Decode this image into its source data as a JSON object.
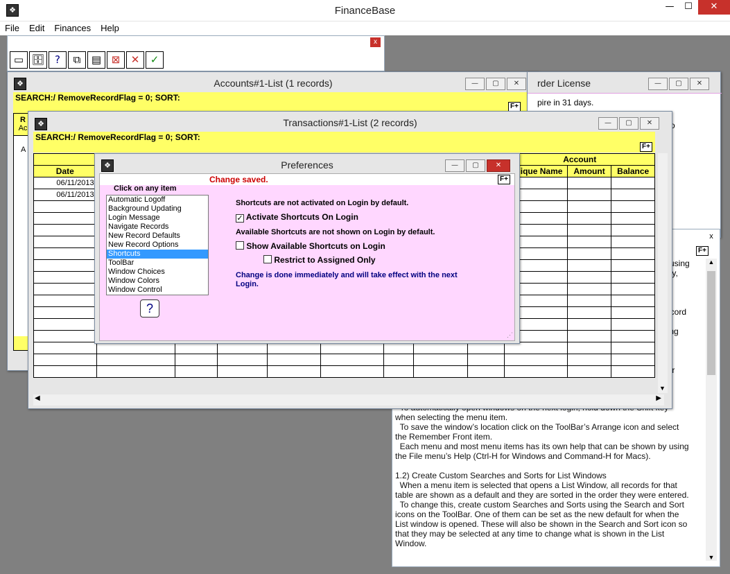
{
  "app": {
    "title": "FinanceBase",
    "min": "—",
    "max": "☐",
    "close": "✕"
  },
  "menu": [
    "File",
    "Edit",
    "Finances",
    "Help"
  ],
  "toolbar": {
    "close": "x",
    "buttons": [
      {
        "icon": "window-icon",
        "glyph": "▭"
      },
      {
        "icon": "database-icon",
        "glyph": "🗄"
      },
      {
        "icon": "help-icon",
        "glyph": "?"
      },
      {
        "icon": "arrange-icon",
        "glyph": "⧉"
      },
      {
        "icon": "records-icon",
        "glyph": "▤"
      },
      {
        "icon": "remove-flag-icon",
        "glyph": "⊠"
      },
      {
        "icon": "cancel-icon",
        "glyph": "✕"
      },
      {
        "icon": "accept-icon",
        "glyph": "✓"
      }
    ]
  },
  "accounts": {
    "title": "Accounts#1-List (1 records)",
    "search": "SEARCH:/ RemoveRecordFlag = 0; SORT:",
    "fplus": "F+",
    "col_frag_1": "R",
    "col_frag_2": "Ac",
    "row_frag": "A"
  },
  "license": {
    "title_frag": "rder License",
    "line1": "pire in 31 days.",
    "line3_frag": "o"
  },
  "transactions": {
    "title": "Transactions#1-List (2 records)",
    "search": "SEARCH:/ RemoveRecordFlag = 0; SORT:",
    "fplus": "F+",
    "col_date": "Date",
    "group_account": "Account",
    "col_unique": "Unique Name",
    "col_amount": "Amount",
    "col_balance": "Balance",
    "rows": [
      "06/11/2013",
      "06/11/2013"
    ]
  },
  "help": {
    "close": "x",
    "fplus": "F+",
    "frag_lines": [
      "n using",
      "day,",
      "",
      "",
      "",
      "record",
      "",
      "bing",
      "",
      "",
      "",
      "her"
    ],
    "text": "  To automatically open windows on the next login, hold down the Shift key\nwhen selecting the menu item.\n  To save the window’s location click on the ToolBar’s Arrange icon and select\nthe Remember Front item.\n  Each menu and most menu items has its own help that can be shown by using\nthe File menu’s Help (Ctrl-H for Windows and Command-H for Macs).\n\n1.2) Create Custom Searches and Sorts for List Windows\n  When a menu item is selected that opens a List Window, all records for that\ntable are shown as a default and they are sorted in the order they were entered.\n  To change this, create custom Searches and Sorts using the Search and Sort\nicons on the ToolBar. One of them can be set as the new default for when the\nList window is opened. These will also be shown in the Search and Sort icon so\nthat they may be selected at any time to change what is shown in the List\nWindow."
  },
  "prefs": {
    "title": "Preferences",
    "status": "Change saved.",
    "fplus": "F+",
    "list_label": "Click on any item",
    "items": [
      "Automatic Logoff",
      "Background Updating",
      "Login Message",
      "Navigate Records",
      "New Record Defaults",
      "New Record Options",
      "Shortcuts",
      "ToolBar",
      "Window Choices",
      "Window Colors",
      "Window Control"
    ],
    "selected": "Shortcuts",
    "help_btn": "?",
    "line1": "Shortcuts are not activated on Login by default.",
    "opt1": "Activate Shortcuts On Login",
    "line2": "Available Shortcuts are not shown on Login by default.",
    "opt2": "Show Available Shortcuts on Login",
    "opt3": "Restrict to Assigned Only",
    "note": "Change is done immediately and will take effect with the next Login."
  },
  "colors": {
    "yellow": "#ffff66",
    "pink": "#ffd7ff",
    "status_red": "#cc0000",
    "note_navy": "#000080",
    "close_red": "#c7312b",
    "list_select": "#3399ff"
  }
}
